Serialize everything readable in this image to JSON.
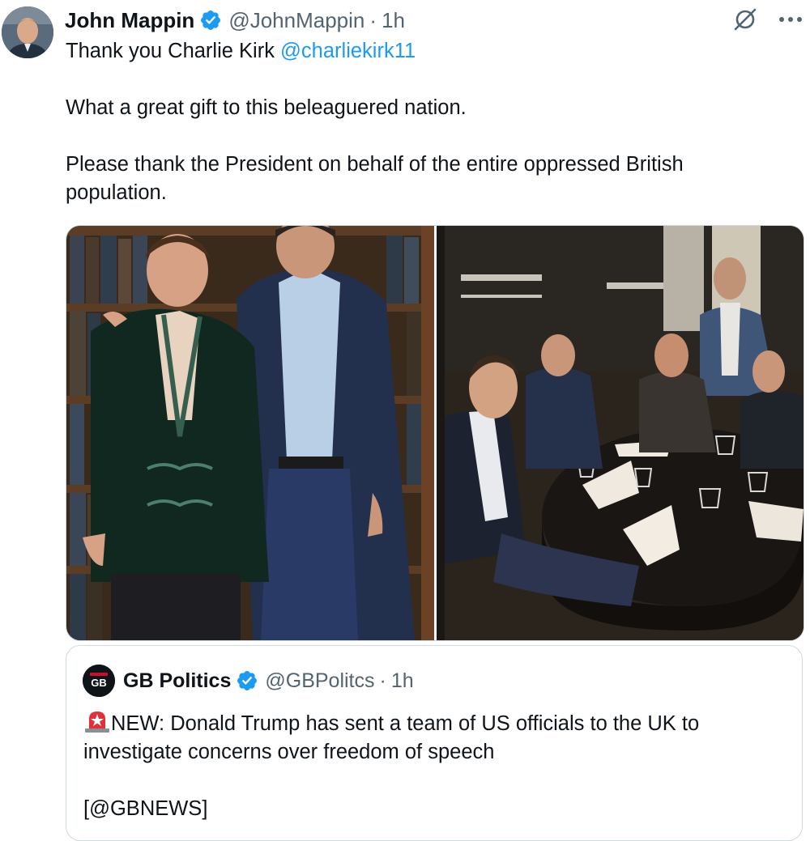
{
  "post": {
    "author_name": "John Mappin",
    "handle": "@JohnMappin",
    "separator": "·",
    "time": "1h",
    "text": {
      "line1": "Thank you Charlie Kirk ",
      "mention": "@charliekirk11",
      "line2": "What a great gift to this beleaguered nation.",
      "line3": "Please thank the President on behalf of the entire oppressed British population."
    }
  },
  "quote": {
    "author_name": "GB Politics",
    "handle": "@GBPolitcs",
    "separator": "·",
    "time": "1h",
    "avatar_text": "GB",
    "text_main": "NEW: Donald Trump has sent a team of US officials to the UK to investigate concerns over freedom of speech",
    "text_source": "[@GBNEWS]"
  },
  "icons": {
    "verified": "verified-badge-icon",
    "grok": "grok-icon",
    "more": "more-options-icon",
    "siren": "rotating-light-emoji-icon"
  },
  "colors": {
    "mention": "#1d9bf0",
    "verified": "#1d9bf0",
    "secondary_text": "#536471",
    "border": "#cfd9de"
  }
}
